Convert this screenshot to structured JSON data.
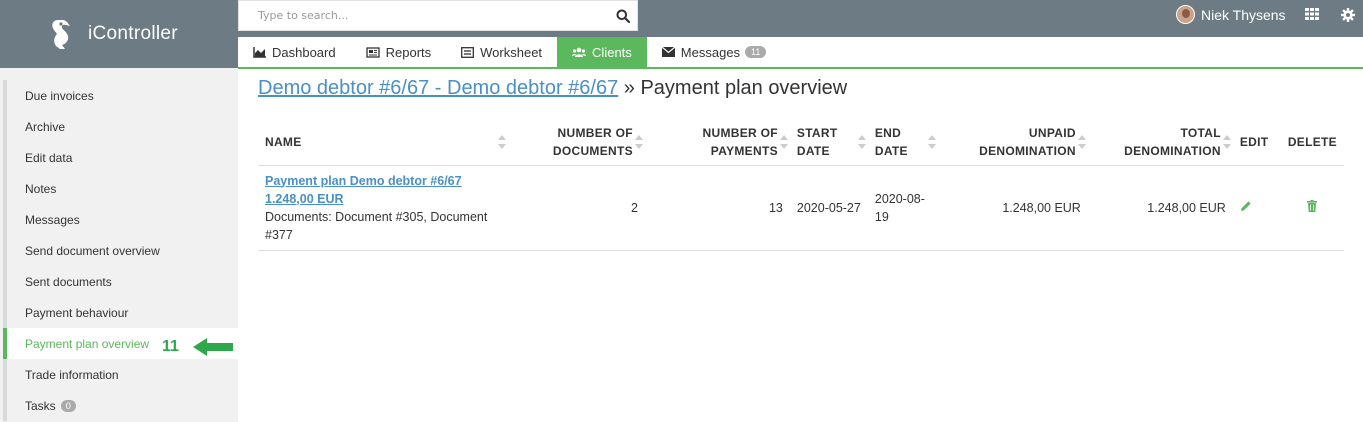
{
  "app": {
    "name": "iController"
  },
  "search": {
    "placeholder": "Type to search..."
  },
  "user": {
    "name": "Niek Thysens"
  },
  "tabs": [
    {
      "label": "Dashboard",
      "icon": "area-chart-icon"
    },
    {
      "label": "Reports",
      "icon": "newspaper-icon"
    },
    {
      "label": "Worksheet",
      "icon": "list-icon"
    },
    {
      "label": "Clients",
      "icon": "users-icon",
      "active": true
    },
    {
      "label": "Messages",
      "icon": "envelope-icon",
      "badge": "11"
    }
  ],
  "sidebar": {
    "items": [
      {
        "label": "Due invoices"
      },
      {
        "label": "Archive"
      },
      {
        "label": "Edit data"
      },
      {
        "label": "Notes"
      },
      {
        "label": "Messages"
      },
      {
        "label": "Send document overview"
      },
      {
        "label": "Sent documents"
      },
      {
        "label": "Payment behaviour"
      },
      {
        "label": "Payment plan overview",
        "active": true
      },
      {
        "label": "Trade information"
      },
      {
        "label": "Tasks",
        "badge": "0"
      }
    ],
    "marker_number": "11"
  },
  "page": {
    "breadcrumb_link": "Demo debtor #6/67 - Demo debtor #6/67",
    "breadcrumb_rest": "» Payment plan overview"
  },
  "table": {
    "headers": {
      "name": "NAME",
      "num_docs": "NUMBER OF DOCUMENTS",
      "num_payments": "NUMBER OF PAYMENTS",
      "start": "START DATE",
      "end": "END DATE",
      "unpaid": "UNPAID DENOMINATION",
      "total": "TOTAL DENOMINATION",
      "edit": "EDIT",
      "delete": "DELETE"
    },
    "rows": [
      {
        "name_link": "Payment plan Demo debtor #6/67 1.248,00 EUR",
        "documents": "Documents: Document #305, Document #377",
        "num_docs": "2",
        "num_payments": "13",
        "start": "2020-05-27",
        "end": "2020-08-19",
        "unpaid": "1.248,00 EUR",
        "total": "1.248,00 EUR"
      }
    ]
  },
  "colors": {
    "accent": "#5cb85c",
    "topbar": "#6c7b84",
    "link": "#4a90c2",
    "arrow": "#2ea84a"
  }
}
